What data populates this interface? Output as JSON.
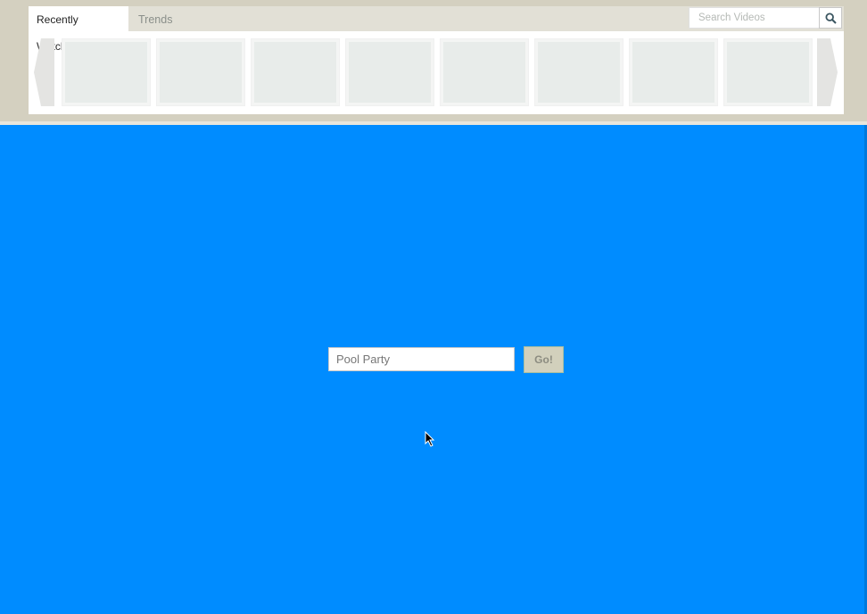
{
  "tabs": {
    "recently_watched": "Recently Watched",
    "trends": "Trends"
  },
  "search": {
    "placeholder": "Search Videos",
    "icon": "search-icon"
  },
  "carousel": {
    "thumbnail_count": 8,
    "prev_icon": "chevron-left-icon",
    "next_icon": "chevron-right-icon"
  },
  "form": {
    "query_value": "Pool Party",
    "go_label": "Go!"
  },
  "colors": {
    "background": "#008cff",
    "header_band": "#d4d0c0",
    "go_button": "#d2d0bc"
  }
}
